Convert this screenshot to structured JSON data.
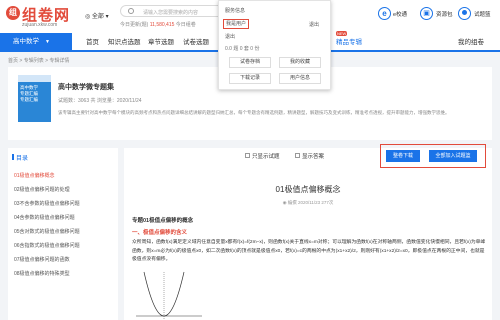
{
  "header": {
    "logo_mark": "组",
    "logo_text": "组卷网",
    "logo_sub": "zujuan.xkw.com",
    "region": "全部",
    "search_placeholder": "请输入您需要搜索的内容",
    "stats_prefix": "今日更新(题)",
    "stats_count": "11,580,415",
    "stats_suffix": "今日组卷",
    "e_label": "e校通",
    "bag_label": "资源包",
    "user_label": "试题篮"
  },
  "nav": {
    "subject": "高中数学",
    "items": [
      {
        "label": "首页",
        "active": false,
        "new": false
      },
      {
        "label": "知识点选题",
        "active": false,
        "new": false
      },
      {
        "label": "章节选题",
        "active": false,
        "new": false
      },
      {
        "label": "试卷选题",
        "active": false,
        "new": false
      },
      {
        "label": "智能",
        "active": false,
        "new": false
      },
      {
        "label": "精品专辑",
        "active": true,
        "new": true
      },
      {
        "label": "我的组卷",
        "active": false,
        "new": false
      }
    ],
    "new_badge": "NEW"
  },
  "dropdown": {
    "service": "服务信息",
    "user_id": "我是用户",
    "logout": "退出",
    "login_state": "退出",
    "counts": "0.0 题    0 套    0 份",
    "buttons": [
      "试卷存档",
      "我的收藏",
      "下载记录",
      "用户信息"
    ]
  },
  "breadcrumb": "首页 > 专辑列表 > 专辑详情",
  "info": {
    "book_lines": [
      "高中数学",
      "专题汇编",
      "专题汇编"
    ],
    "title": "高中数学微专题集",
    "meta": "试题数：3063 共    浏览量：2020/11/24",
    "desc": "该专辑高主要针对高中数学每个模块的高频考点和热点问题详细总结讲解的题型归纳汇总，每个专题含有精选例题，精讲题型，解题技巧及变式训练，精准考点透视，提升审题能力，增强数学思维。"
  },
  "toc": {
    "title": "目录",
    "items": [
      {
        "label": "01极值点偏移概念",
        "active": true
      },
      {
        "label": "02极值点偏移问题的处理",
        "active": false
      },
      {
        "label": "03不含参数的极值点偏移问题",
        "active": false
      },
      {
        "label": "04含参数的极值点偏移问题",
        "active": false
      },
      {
        "label": "05含对数式的极值点偏移问题",
        "active": false
      },
      {
        "label": "06含指数式的极值点偏移问题",
        "active": false
      },
      {
        "label": "07极值点偏移问题的函数",
        "active": false
      },
      {
        "label": "08极值点偏移的特殊类型",
        "active": false
      }
    ]
  },
  "toolbar": {
    "only_show": "只显示试题",
    "show_answer": "显示答案",
    "download": "整卷下载",
    "add_all": "全部加入试题篮"
  },
  "doc": {
    "title": "01极值点偏移概念",
    "meta": "◉  编撰          2020/11/23          277次",
    "section": "专题01极值点偏移的概念",
    "subsection": "一、极值点偏移的含义",
    "body": "众所周知，函数f(x)满足定义域内任意自变量x都有f(x)=f(2m−x)，则函数f(x)关于直线x=m对称；可以理解为函数f(x)在对称轴两侧，函数值变化快慢相同，且若f(x)为单峰函数，则x=m必为f(x)的极值点x0，如二次函数f(x)的顶点就是极值点x0，若f(x)=c的两根的中点为(x1+x2)/2，则刚好有(x1+x2)/2=x0，即极值点在两根的正中间，也就是极值点没有偏移。"
  }
}
